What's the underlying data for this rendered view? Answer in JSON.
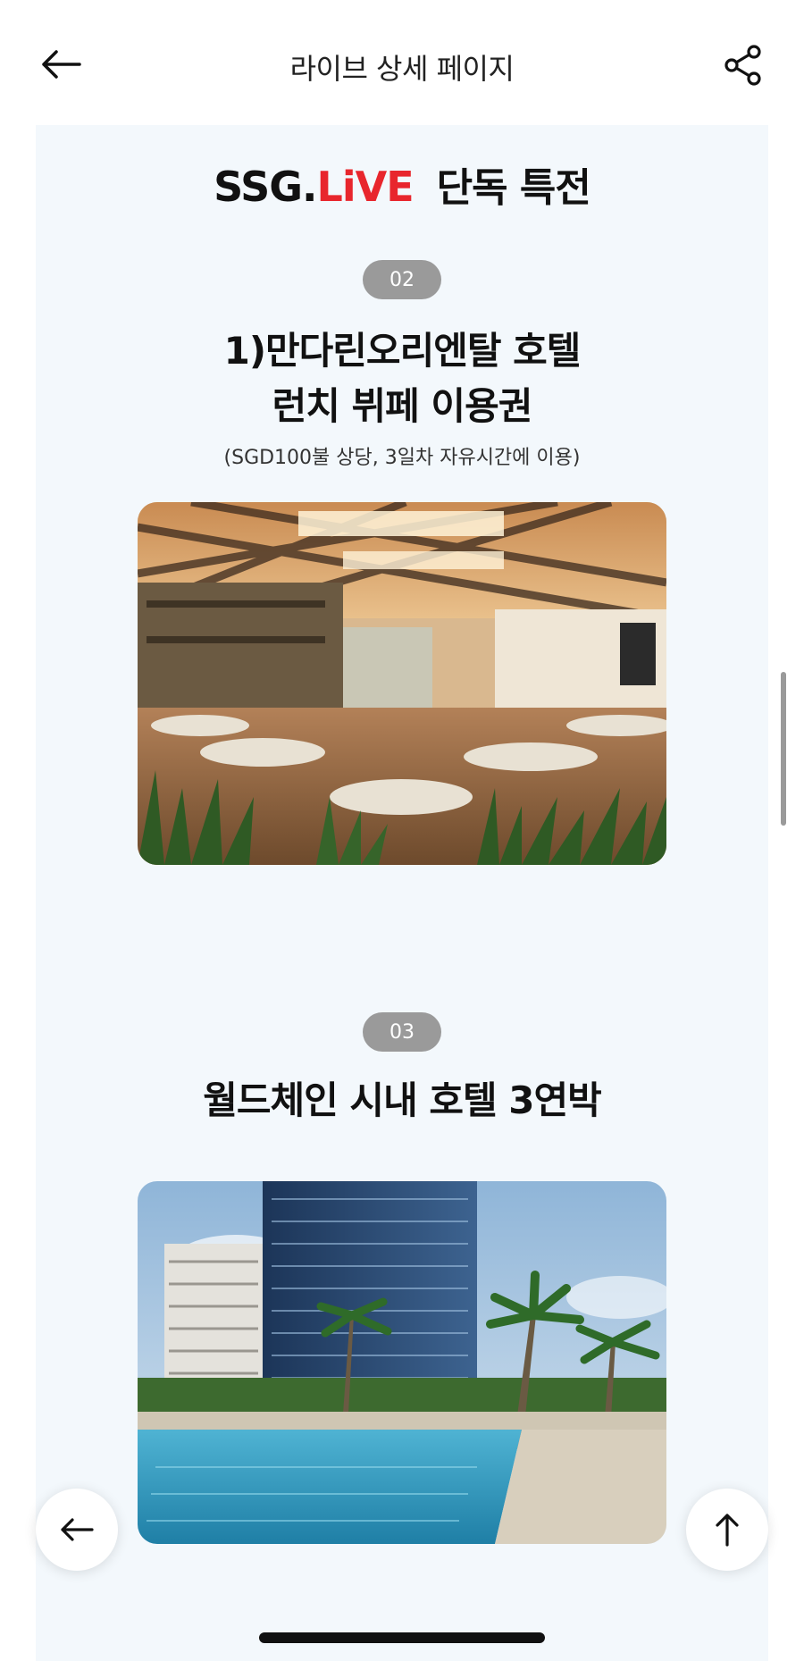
{
  "header": {
    "title": "라이브 상세 페이지",
    "back_icon": "arrow-left-icon",
    "share_icon": "share-icon"
  },
  "brand": {
    "ssg": "SSG.",
    "live": "LiVE",
    "sub": "단독 특전",
    "accent_color": "#e8262d"
  },
  "sections": [
    {
      "badge": "02",
      "title_line1": "1)만다린오리엔탈 호텔",
      "title_line2": "런치 뷔페 이용권",
      "subtitle": "(SGD100불 상당, 3일차 자유시간에 이용)",
      "image": "restaurant-interior-photo"
    },
    {
      "badge": "03",
      "title_line1": "월드체인 시내 호텔 3연박",
      "image": "hotel-pool-photo"
    }
  ],
  "floating": {
    "back_icon": "arrow-left-icon",
    "top_icon": "arrow-up-icon"
  }
}
